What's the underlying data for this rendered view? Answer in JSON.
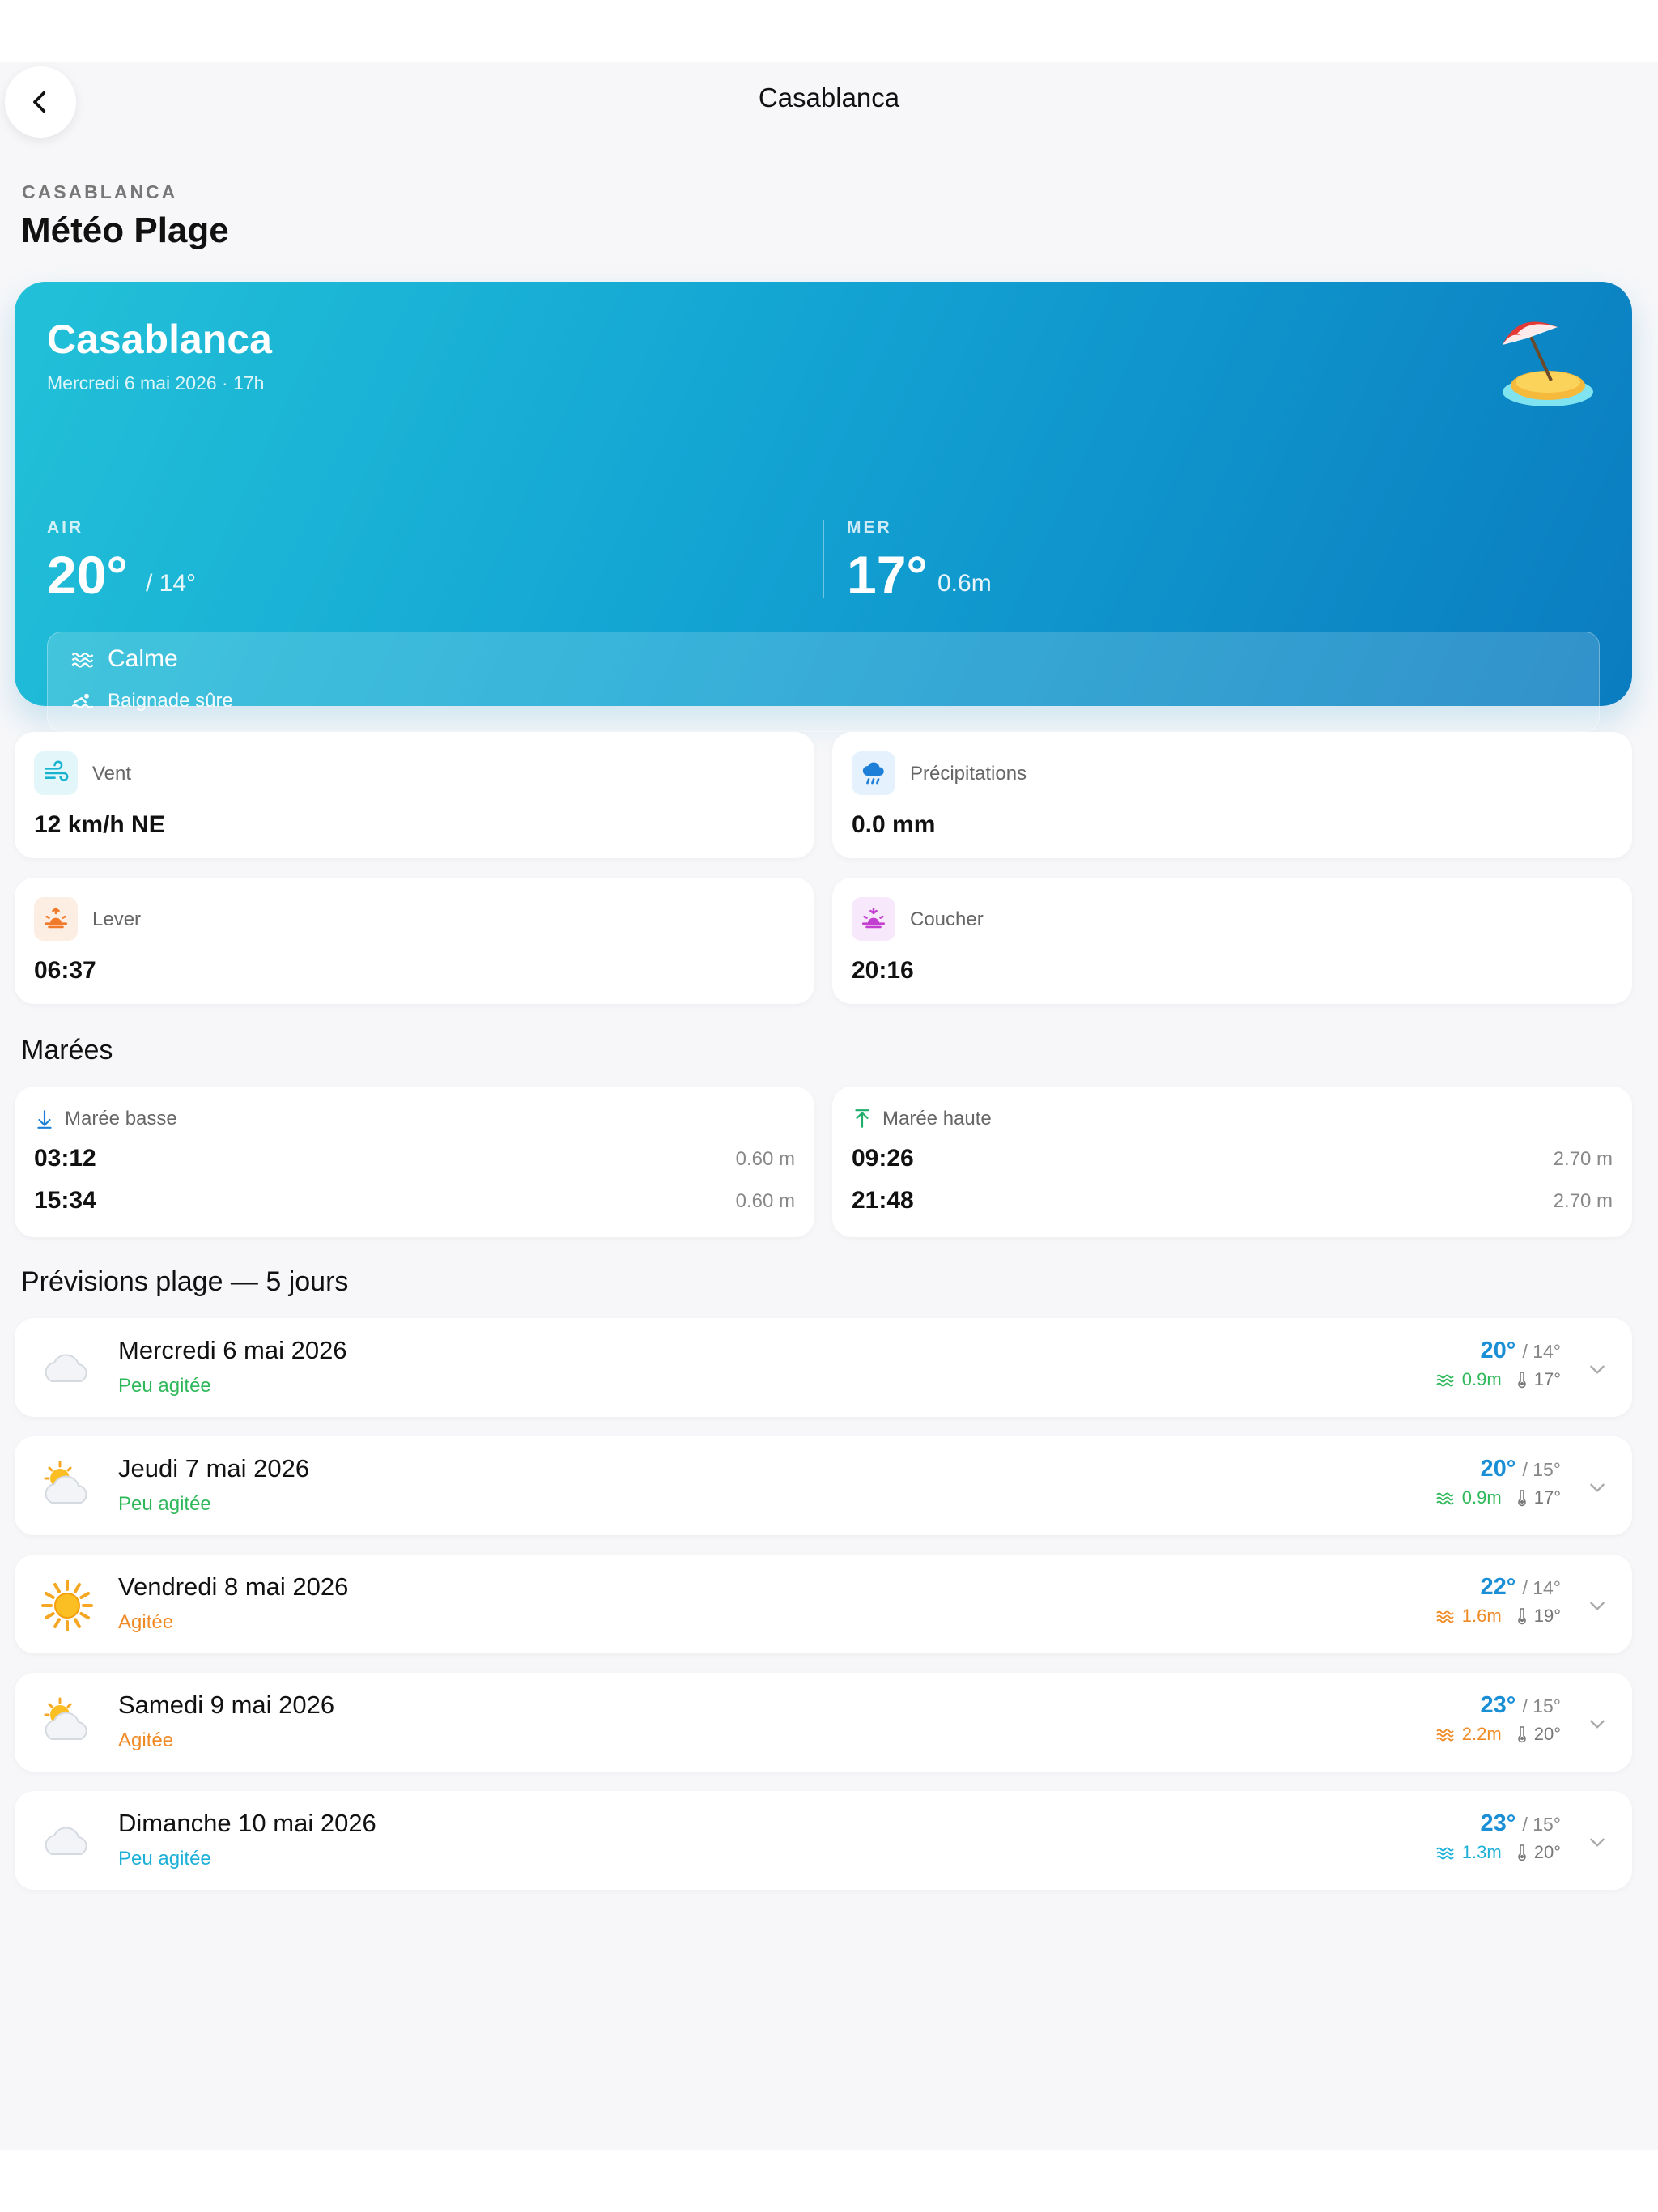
{
  "nav": {
    "title": "Casablanca"
  },
  "header": {
    "eyebrow": "CASABLANCA",
    "title": "Météo Plage"
  },
  "hero": {
    "city": "Casablanca",
    "date": "Mercredi 6 mai 2026 · 17h",
    "air_label": "AIR",
    "air_temp": "20°",
    "air_min": "/ 14°",
    "sea_label": "MER",
    "sea_temp": "17°",
    "sea_wave": "0.6m",
    "sea_state": "Calme",
    "swim": "Baignade sûre"
  },
  "stats": [
    {
      "label": "Vent",
      "value": "12 km/h NE",
      "icon": "wind-icon"
    },
    {
      "label": "Précipitations",
      "value": "0.0 mm",
      "icon": "rain-cloud-icon"
    },
    {
      "label": "Lever",
      "value": "06:37",
      "icon": "sunrise-icon"
    },
    {
      "label": "Coucher",
      "value": "20:16",
      "icon": "sunset-icon"
    }
  ],
  "tides": {
    "title": "Marées",
    "low": {
      "label": "Marée basse",
      "entries": [
        {
          "time": "03:12",
          "height": "0.60 m"
        },
        {
          "time": "15:34",
          "height": "0.60 m"
        }
      ]
    },
    "high": {
      "label": "Marée haute",
      "entries": [
        {
          "time": "09:26",
          "height": "2.70 m"
        },
        {
          "time": "21:48",
          "height": "2.70 m"
        }
      ]
    }
  },
  "forecast": {
    "title": "Prévisions plage — 5 jours",
    "days": [
      {
        "day": "Mercredi 6 mai 2026",
        "cond": "Peu agitée",
        "hi": "20°",
        "lo": "/ 14°",
        "wave": "0.9m",
        "water": "17°",
        "icon": "cloud-icon",
        "color": "#2fb85a"
      },
      {
        "day": "Jeudi 7 mai 2026",
        "cond": "Peu agitée",
        "hi": "20°",
        "lo": "/ 15°",
        "wave": "0.9m",
        "water": "17°",
        "icon": "sun-behind-cloud-icon",
        "color": "#2fb85a"
      },
      {
        "day": "Vendredi 8 mai 2026",
        "cond": "Agitée",
        "hi": "22°",
        "lo": "/ 14°",
        "wave": "1.6m",
        "water": "19°",
        "icon": "sun-icon",
        "color": "#f08a24"
      },
      {
        "day": "Samedi 9 mai 2026",
        "cond": "Agitée",
        "hi": "23°",
        "lo": "/ 15°",
        "wave": "2.2m",
        "water": "20°",
        "icon": "sun-behind-cloud-icon",
        "color": "#f08a24"
      },
      {
        "day": "Dimanche 10 mai 2026",
        "cond": "Peu agitée",
        "hi": "23°",
        "lo": "/ 15°",
        "wave": "1.3m",
        "water": "20°",
        "icon": "cloud-icon",
        "color": "#1cb0d8"
      }
    ]
  }
}
